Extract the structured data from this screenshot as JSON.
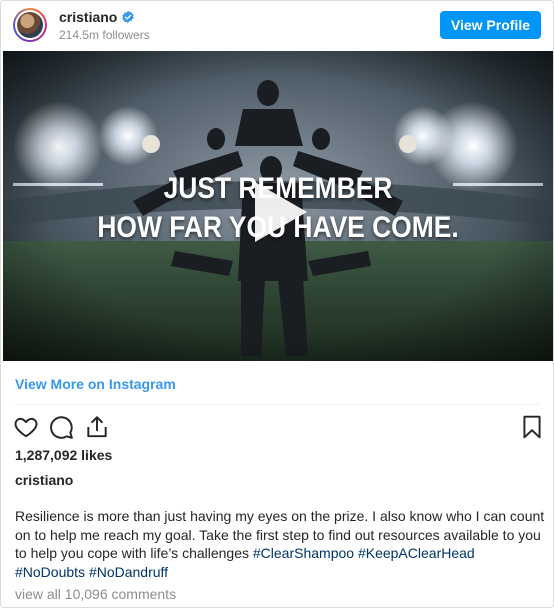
{
  "header": {
    "username": "cristiano",
    "followers": "214.5m followers",
    "view_profile_label": "View Profile"
  },
  "media": {
    "overlay_line1": "JUST REMEMBER",
    "overlay_line2": "HOW FAR YOU HAVE COME."
  },
  "view_more_label": "View More on Instagram",
  "actions": {
    "icons": [
      "heart-icon",
      "comment-icon",
      "share-icon",
      "bookmark-icon"
    ]
  },
  "likes": "1,287,092 likes",
  "caption": {
    "username": "cristiano",
    "text": "Resilience is more than just having my eyes on the prize. I also know who I can count on to help me reach my goal. Take the first step to find out resources available to you to help you cope with life’s challenges ",
    "hashtags": [
      "#ClearShampoo",
      "#KeepAClearHead",
      "#NoDoubts",
      "#NoDandruff"
    ]
  },
  "view_comments_label": "view all 10,096 comments",
  "colors": {
    "accent": "#0095f6",
    "link": "#3897f0",
    "hashtag": "#003569",
    "muted": "#8e8e8e",
    "verified": "#3897f0"
  }
}
